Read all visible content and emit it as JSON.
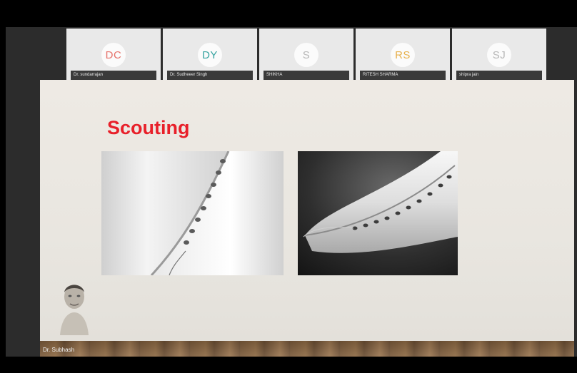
{
  "participants": [
    {
      "initials": "DC",
      "name": "Dr. sundarrajan",
      "color": "#e6726a"
    },
    {
      "initials": "DY",
      "name": "Dr. Sudheeer Singh",
      "color": "#36a3a0"
    },
    {
      "initials": "S",
      "name": "SHIKHA",
      "color": "#b6b6b6"
    },
    {
      "initials": "RS",
      "name": "RITESH SHARMA",
      "color": "#e7b04a"
    },
    {
      "initials": "SJ",
      "name": "shipra jain",
      "color": "#b6b6b6"
    }
  ],
  "slide": {
    "title": "Scouting",
    "presenter_label": "Dr. Subhash"
  },
  "colors": {
    "title": "#e8202a",
    "tile_bg": "#e9e9e9",
    "name_bar": "#3a3a3a"
  }
}
